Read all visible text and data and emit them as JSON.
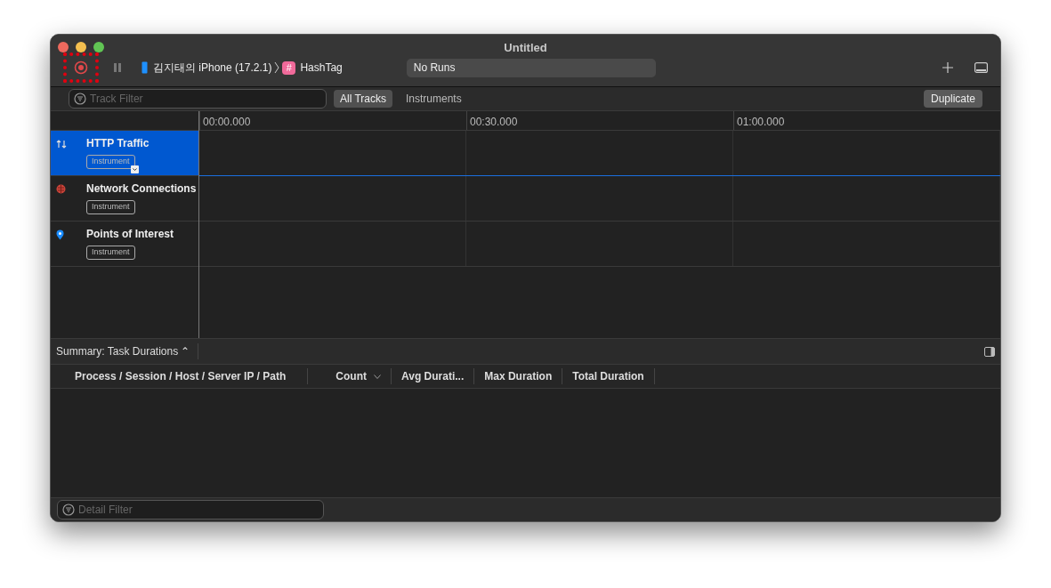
{
  "window": {
    "title": "Untitled"
  },
  "toolbar": {
    "record_highlighted": true,
    "device": "김지태의 iPhone (17.2.1)",
    "app_icon": "#",
    "app": "HashTag",
    "runs": "No Runs"
  },
  "track_filter": {
    "placeholder": "Track Filter"
  },
  "scope_tabs": [
    {
      "label": "All Tracks",
      "selected": true
    },
    {
      "label": "Instruments",
      "selected": false
    }
  ],
  "duplicate_button": "Duplicate",
  "ruler": [
    "00:00.000",
    "00:30.000",
    "01:00.000"
  ],
  "tracks": [
    {
      "kind": "http",
      "name": "HTTP Traffic",
      "tag": "Instrument",
      "selected": true
    },
    {
      "kind": "network",
      "name": "Network Connections",
      "tag": "Instrument",
      "selected": false
    },
    {
      "kind": "poi",
      "name": "Points of Interest",
      "tag": "Instrument",
      "selected": false
    }
  ],
  "summary": {
    "label": "Summary: Task Durations ⌃"
  },
  "table": {
    "columns": [
      {
        "label": "Process / Session / Host / Server IP / Path",
        "sorted": false
      },
      {
        "label": "Count",
        "sorted": true
      },
      {
        "label": "Avg Durati...",
        "sorted": false
      },
      {
        "label": "Max Duration",
        "sorted": false
      },
      {
        "label": "Total Duration",
        "sorted": false
      }
    ]
  },
  "detail_filter": {
    "placeholder": "Detail Filter"
  }
}
